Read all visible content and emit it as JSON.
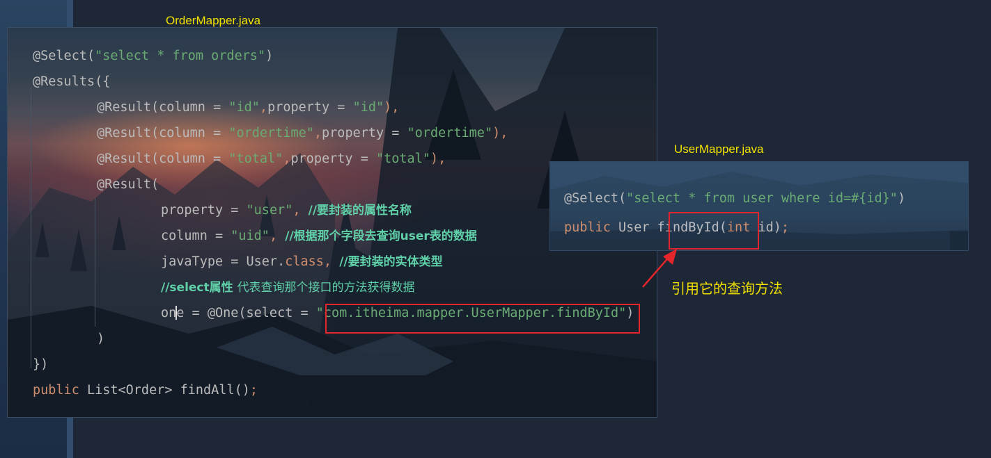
{
  "order_file": {
    "filename": "OrderMapper.java",
    "lines": {
      "l1": {
        "a": "@Select(",
        "b": "\"select * from orders\"",
        "c": ")"
      },
      "l2": {
        "a": "@Results({"
      },
      "l3": {
        "a": "@Result(column = ",
        "b": "\"id\"",
        "c": ",",
        "d": "property = ",
        "e": "\"id\"",
        "f": "),"
      },
      "l4": {
        "a": "@Result(column = ",
        "b": "\"ordertime\"",
        "c": ",",
        "d": "property = ",
        "e": "\"ordertime\"",
        "f": "),"
      },
      "l5": {
        "a": "@Result(column = ",
        "b": "\"total\"",
        "c": ",",
        "d": "property = ",
        "e": "\"total\"",
        "f": "),"
      },
      "l6": {
        "a": "@Result("
      },
      "l7": {
        "a": "property = ",
        "b": "\"user\"",
        "c": ", ",
        "d": "//要封装的属性名称"
      },
      "l8": {
        "a": "column = ",
        "b": "\"uid\"",
        "c": ", ",
        "d": "//根据那个字段去查询user表的数据"
      },
      "l9": {
        "a": "javaType = User.",
        "b": "class",
        "c": ", ",
        "d": "//要封装的实体类型"
      },
      "l10": {
        "a": "//select属性 ",
        "b": "代表查询那个接口的方法获得数据"
      },
      "l11": {
        "a": "on",
        "b": "e = @One(select = ",
        "c": "\"com.itheima.mapper.UserMapper.findById\"",
        "d": ")"
      },
      "l12": {
        "a": ")"
      },
      "l13": {
        "a": "})"
      },
      "l14": {
        "a": "public ",
        "b": "List<Order> findAll()",
        "c": ";"
      }
    }
  },
  "user_file": {
    "filename": "UserMapper.java",
    "lines": {
      "l1": {
        "a": "@Select(",
        "b": "\"select * from user where id=#{id}\"",
        "c": ")"
      },
      "l2": {
        "a": "public ",
        "b": "User ",
        "c": "findById(",
        "d": "int ",
        "e": "id)",
        "f": ";"
      }
    }
  },
  "callout": {
    "text": "引用它的查询方法"
  },
  "colors": {
    "highlight": "#e3262b",
    "label": "#f2e000",
    "string": "#6aab73",
    "keyword": "#cf8e6d",
    "comment": "#5fd0a8"
  }
}
